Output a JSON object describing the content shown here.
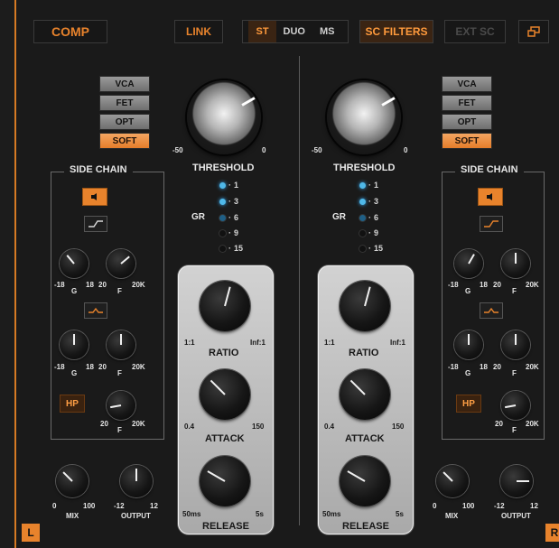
{
  "topbar": {
    "comp": "COMP",
    "link": "LINK",
    "modes": [
      "ST",
      "DUO",
      "MS"
    ],
    "active_mode": "ST",
    "sc_filters": "SC FILTERS",
    "ext_sc": "EXT SC"
  },
  "left": {
    "channel": "L",
    "types": [
      "VCA",
      "FET",
      "OPT",
      "SOFT"
    ],
    "active_type": "SOFT",
    "threshold": {
      "label": "THRESHOLD",
      "min": "-50",
      "max": "0"
    },
    "gr": {
      "label": "GR",
      "marks": [
        "1",
        "3",
        "6",
        "9",
        "15"
      ],
      "lit": 3
    },
    "ratio": {
      "label": "RATIO",
      "min": "1:1",
      "max": "Inf:1"
    },
    "attack": {
      "label": "ATTACK",
      "min": "0.4",
      "max": "150"
    },
    "release": {
      "label": "RELEASE",
      "min": "50ms",
      "max": "5s"
    },
    "sidechain": {
      "title": "SIDE CHAIN",
      "band1": {
        "g": "G",
        "gmin": "-18",
        "gmax": "18",
        "f": "F",
        "fmin": "20",
        "fmax": "20K"
      },
      "band2": {
        "g": "G",
        "gmin": "-18",
        "gmax": "18",
        "f": "F",
        "fmin": "20",
        "fmax": "20K"
      },
      "hp": {
        "label": "HP",
        "f": "F",
        "fmin": "20",
        "fmax": "20K"
      }
    },
    "mix": {
      "label": "MIX",
      "min": "0",
      "max": "100"
    },
    "output": {
      "label": "OUTPUT",
      "min": "-12",
      "max": "12"
    }
  },
  "right": {
    "channel": "R",
    "types": [
      "VCA",
      "FET",
      "OPT",
      "SOFT"
    ],
    "active_type": "SOFT",
    "threshold": {
      "label": "THRESHOLD",
      "min": "-50",
      "max": "0"
    },
    "gr": {
      "label": "GR",
      "marks": [
        "1",
        "3",
        "6",
        "9",
        "15"
      ],
      "lit": 3
    },
    "ratio": {
      "label": "RATIO",
      "min": "1:1",
      "max": "Inf:1"
    },
    "attack": {
      "label": "ATTACK",
      "min": "0.4",
      "max": "150"
    },
    "release": {
      "label": "RELEASE",
      "min": "50ms",
      "max": "5s"
    },
    "sidechain": {
      "title": "SIDE CHAIN",
      "band1": {
        "g": "G",
        "gmin": "-18",
        "gmax": "18",
        "f": "F",
        "fmin": "20",
        "fmax": "20K"
      },
      "band2": {
        "g": "G",
        "gmin": "-18",
        "gmax": "18",
        "f": "F",
        "fmin": "20",
        "fmax": "20K"
      },
      "hp": {
        "label": "HP",
        "f": "F",
        "fmin": "20",
        "fmax": "20K"
      }
    },
    "mix": {
      "label": "MIX",
      "min": "0",
      "max": "100"
    },
    "output": {
      "label": "OUTPUT",
      "min": "-12",
      "max": "12"
    }
  },
  "icons": {
    "window": "window-icon",
    "speaker": "speaker-icon",
    "shelf": "shelf-filter-icon",
    "bell": "bell-filter-icon"
  },
  "colors": {
    "accent": "#e8832c",
    "led": "#4fb8e8"
  }
}
